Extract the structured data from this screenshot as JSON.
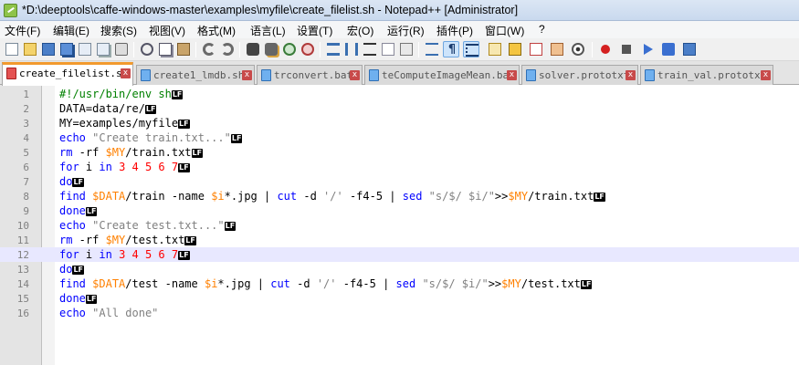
{
  "window": {
    "title": "*D:\\deeptools\\caffe-windows-master\\examples\\myfile\\create_filelist.sh - Notepad++ [Administrator]",
    "app_icon": "notepadpp-icon"
  },
  "menu": [
    "文件(F)",
    "编辑(E)",
    "搜索(S)",
    "视图(V)",
    "格式(M)",
    "语言(L)",
    "设置(T)",
    "宏(O)",
    "运行(R)",
    "插件(P)",
    "窗口(W)",
    "?"
  ],
  "toolbar": {
    "icons": [
      "new-file-icon",
      "open-file-icon",
      "save-icon",
      "save-all-icon",
      "close-icon",
      "close-all-icon",
      "print-icon",
      "cut-icon",
      "copy-icon",
      "paste-icon",
      "undo-icon",
      "redo-icon",
      "find-icon",
      "replace-icon",
      "zoom-in-icon",
      "zoom-out-icon",
      "sync-scroll-vertical-icon",
      "sync-scroll-horizontal-icon",
      "word-wrap-icon",
      "show-all-characters-icon",
      "indent-guide-icon",
      "user-defined-language-icon",
      "document-map-icon",
      "function-list-icon",
      "folder-as-workspace-icon",
      "monitoring-icon",
      "record-macro-icon",
      "stop-recording-icon",
      "playback-macro-icon",
      "run-macro-multiple-icon",
      "save-macro-icon"
    ]
  },
  "tabs": [
    {
      "label": "create_filelist.sh",
      "active": true,
      "close": "x"
    },
    {
      "label": "create1_lmdb.sh",
      "active": false,
      "close": "x"
    },
    {
      "label": "trconvert.bat",
      "active": false,
      "close": "x"
    },
    {
      "label": "teComputeImageMean.bat",
      "active": false,
      "close": "x"
    },
    {
      "label": "solver.prototxt",
      "active": false,
      "close": "x"
    },
    {
      "label": "train_val.prototxt",
      "active": false,
      "close": "x"
    }
  ],
  "eol_marker": "LF",
  "editor": {
    "current_line": 12,
    "lines": [
      {
        "n": "1",
        "segments": [
          {
            "t": "#!/usr/bin/env sh",
            "c": "cm"
          }
        ]
      },
      {
        "n": "2",
        "segments": [
          {
            "t": "DATA=data/re/",
            "c": ""
          }
        ]
      },
      {
        "n": "3",
        "segments": [
          {
            "t": "MY=examples/myfile",
            "c": ""
          }
        ]
      },
      {
        "n": "4",
        "segments": [
          {
            "t": "echo",
            "c": "kw"
          },
          {
            "t": " ",
            "c": ""
          },
          {
            "t": "\"Create train.txt...\"",
            "c": "str"
          }
        ]
      },
      {
        "n": "5",
        "segments": [
          {
            "t": "rm",
            "c": "kw"
          },
          {
            "t": " -rf ",
            "c": ""
          },
          {
            "t": "$MY",
            "c": "var"
          },
          {
            "t": "/train.txt",
            "c": ""
          }
        ]
      },
      {
        "n": "6",
        "segments": [
          {
            "t": "for",
            "c": "kw"
          },
          {
            "t": " i ",
            "c": ""
          },
          {
            "t": "in",
            "c": "kw"
          },
          {
            "t": " ",
            "c": ""
          },
          {
            "t": "3 4 5 6 7",
            "c": "num"
          }
        ]
      },
      {
        "n": "7",
        "segments": [
          {
            "t": "do",
            "c": "kw"
          }
        ]
      },
      {
        "n": "8",
        "segments": [
          {
            "t": "find",
            "c": "kw"
          },
          {
            "t": " ",
            "c": ""
          },
          {
            "t": "$DATA",
            "c": "var"
          },
          {
            "t": "/train -name ",
            "c": ""
          },
          {
            "t": "$i",
            "c": "var"
          },
          {
            "t": "*.jpg | ",
            "c": ""
          },
          {
            "t": "cut",
            "c": "kw"
          },
          {
            "t": " -d ",
            "c": ""
          },
          {
            "t": "'/'",
            "c": "str"
          },
          {
            "t": " -f4-5 | ",
            "c": ""
          },
          {
            "t": "sed",
            "c": "kw"
          },
          {
            "t": " ",
            "c": ""
          },
          {
            "t": "\"s/$/ $i/\"",
            "c": "str"
          },
          {
            "t": ">>",
            "c": ""
          },
          {
            "t": "$MY",
            "c": "var"
          },
          {
            "t": "/train.txt",
            "c": ""
          }
        ]
      },
      {
        "n": "9",
        "segments": [
          {
            "t": "done",
            "c": "kw"
          }
        ]
      },
      {
        "n": "10",
        "segments": [
          {
            "t": "echo",
            "c": "kw"
          },
          {
            "t": " ",
            "c": ""
          },
          {
            "t": "\"Create test.txt...\"",
            "c": "str"
          }
        ]
      },
      {
        "n": "11",
        "segments": [
          {
            "t": "rm",
            "c": "kw"
          },
          {
            "t": " -rf ",
            "c": ""
          },
          {
            "t": "$MY",
            "c": "var"
          },
          {
            "t": "/test.txt",
            "c": ""
          }
        ]
      },
      {
        "n": "12",
        "segments": [
          {
            "t": "for",
            "c": "kw"
          },
          {
            "t": " i ",
            "c": ""
          },
          {
            "t": "in",
            "c": "kw"
          },
          {
            "t": " ",
            "c": ""
          },
          {
            "t": "3 4 5 6 7",
            "c": "num"
          }
        ]
      },
      {
        "n": "13",
        "segments": [
          {
            "t": "do",
            "c": "kw"
          }
        ]
      },
      {
        "n": "14",
        "segments": [
          {
            "t": "find",
            "c": "kw"
          },
          {
            "t": " ",
            "c": ""
          },
          {
            "t": "$DATA",
            "c": "var"
          },
          {
            "t": "/test -name ",
            "c": ""
          },
          {
            "t": "$i",
            "c": "var"
          },
          {
            "t": "*.jpg | ",
            "c": ""
          },
          {
            "t": "cut",
            "c": "kw"
          },
          {
            "t": " -d ",
            "c": ""
          },
          {
            "t": "'/'",
            "c": "str"
          },
          {
            "t": " -f4-5 | ",
            "c": ""
          },
          {
            "t": "sed",
            "c": "kw"
          },
          {
            "t": " ",
            "c": ""
          },
          {
            "t": "\"s/$/ $i/\"",
            "c": "str"
          },
          {
            "t": ">>",
            "c": ""
          },
          {
            "t": "$MY",
            "c": "var"
          },
          {
            "t": "/test.txt",
            "c": ""
          }
        ]
      },
      {
        "n": "15",
        "segments": [
          {
            "t": "done",
            "c": "kw"
          }
        ]
      },
      {
        "n": "16",
        "segments": [
          {
            "t": "echo",
            "c": "kw"
          },
          {
            "t": " ",
            "c": ""
          },
          {
            "t": "\"All done\"",
            "c": "str"
          }
        ],
        "no_eol": true
      }
    ]
  },
  "colors": {
    "keyword": "#0000ff",
    "variable": "#ff8000",
    "number": "#ff0000",
    "string": "#808080",
    "comment": "#008000",
    "active_tab_accent": "#f29a2e",
    "current_line": "#e8e8ff"
  }
}
